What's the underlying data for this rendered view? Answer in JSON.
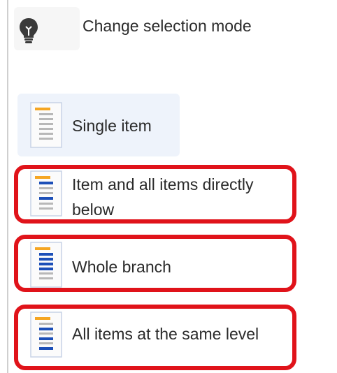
{
  "header": {
    "icon": "lightbulb-icon",
    "title": "Change selection mode"
  },
  "modes": [
    {
      "label": "Single item",
      "icon": "single-item-icon",
      "selected": true
    },
    {
      "label": "Item and all items directly below",
      "line1": "Item and all items directly",
      "line2": "below",
      "icon": "item-and-children-icon",
      "selected": false
    },
    {
      "label": "Whole branch",
      "icon": "whole-branch-icon",
      "selected": false
    },
    {
      "label": "All items at the same level",
      "icon": "same-level-icon",
      "selected": false
    }
  ],
  "colors": {
    "accent_orange": "#f5a623",
    "accent_blue": "#1c4fb8",
    "highlight_red": "#e0131a",
    "selected_bg": "#eef3fb"
  }
}
